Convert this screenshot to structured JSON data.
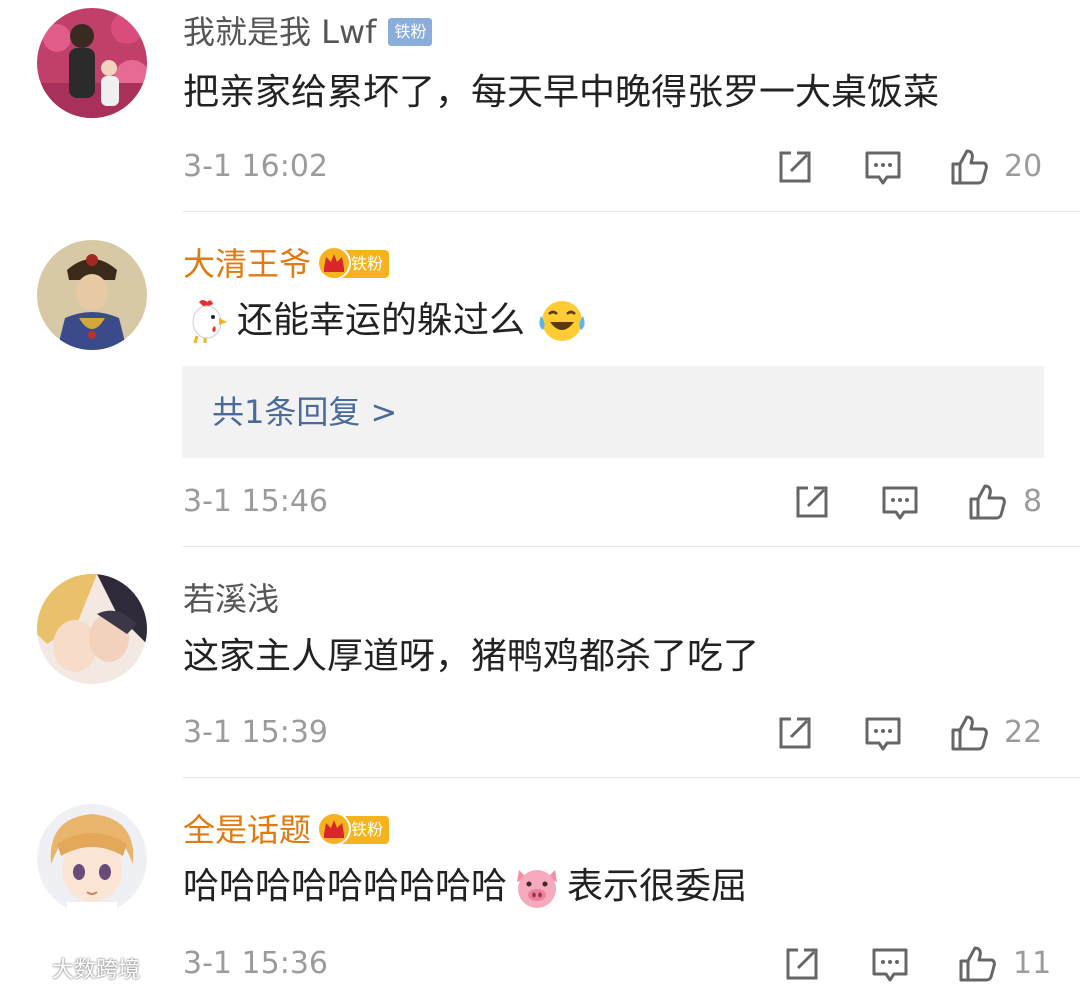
{
  "comments": [
    {
      "username": "我就是我 Lwf",
      "badge": "铁粉",
      "badge_style": "blue",
      "text": "把亲家给累坏了，每天早中晚得张罗一大桌饭菜",
      "time": "3-1 16:02",
      "likes": "20"
    },
    {
      "username": "大清王爷",
      "badge": "铁粉",
      "badge_style": "gold",
      "text_emoji_before": "rooster-emoji",
      "text": "还能幸运的躲过么",
      "text_emoji_after": "laugh-cry-emoji",
      "reply_link": "共1条回复 >",
      "time": "3-1 15:46",
      "likes": "8"
    },
    {
      "username": "若溪浅",
      "text": "这家主人厚道呀，猪鸭鸡都杀了吃了",
      "time": "3-1 15:39",
      "likes": "22"
    },
    {
      "username": "全是话题",
      "badge": "铁粉",
      "badge_style": "gold",
      "text": "哈哈哈哈哈哈哈哈哈",
      "text_emoji_after": "pig-face-emoji",
      "text_after_emoji": "表示很委屈",
      "time": "3-1 15:36",
      "likes": "11"
    }
  ],
  "colors": {
    "vip_name": "#e07a12",
    "plain_name": "#555555",
    "meta_gray": "#9b9b9b",
    "reply_link": "#4a6a99",
    "reply_bg": "#f2f2f2",
    "badge_blue": "#8aaed9",
    "badge_gold": "#f5b41f"
  },
  "actions": [
    "share-icon",
    "comment-icon",
    "like-icon"
  ],
  "watermark": "大数跨境"
}
